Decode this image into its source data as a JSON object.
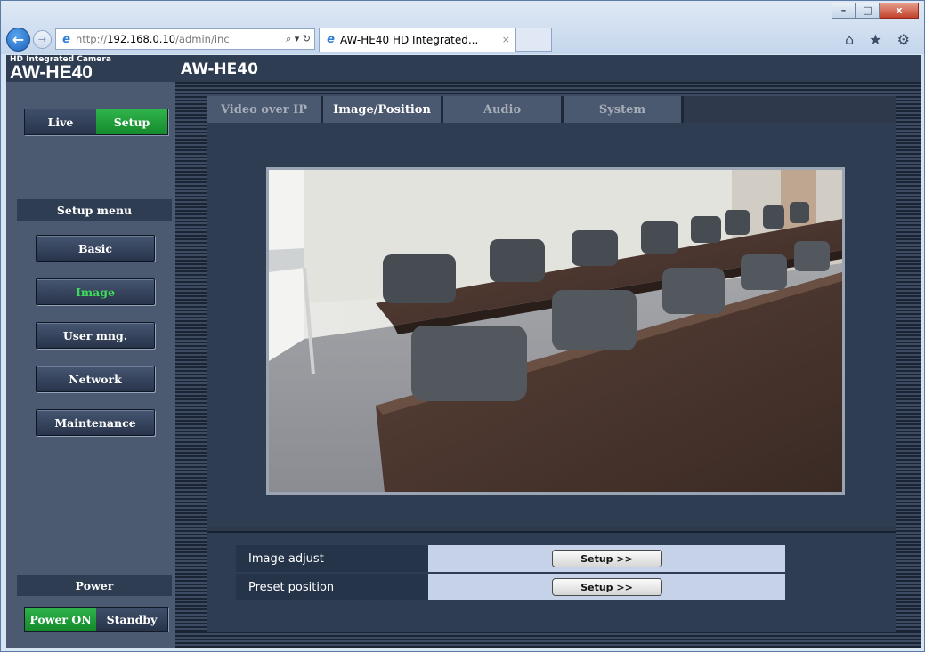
{
  "browser": {
    "address_prefix": "http://",
    "address_host": "192.168.0.10",
    "address_rest": "/admin/inc",
    "address_tools": "⌕ ▾ ↻",
    "tab_title": "AW-HE40 HD Integrated...",
    "tab_close": "×",
    "window_controls": [
      "–",
      "□",
      "x"
    ],
    "toolbar_icons": "⌂ ★ ⚙"
  },
  "header": {
    "brand_small": "HD Integrated Camera",
    "brand_big": "AW-HE40",
    "title": "AW-HE40"
  },
  "mode": {
    "live": "Live",
    "setup": "Setup",
    "active": "setup"
  },
  "setup_menu": {
    "title": "Setup menu",
    "items": [
      {
        "label": "Basic",
        "active": false
      },
      {
        "label": "Image",
        "active": true
      },
      {
        "label": "User mng.",
        "active": false
      },
      {
        "label": "Network",
        "active": false
      },
      {
        "label": "Maintenance",
        "active": false
      }
    ]
  },
  "power": {
    "title": "Power",
    "on": "Power ON",
    "standby": "Standby",
    "active": "on"
  },
  "tabs": [
    {
      "label": "Video over IP",
      "active": false
    },
    {
      "label": "Image/Position",
      "active": true
    },
    {
      "label": "Audio",
      "active": false
    },
    {
      "label": "System",
      "active": false
    }
  ],
  "settings": [
    {
      "label": "Image adjust",
      "button": "Setup >>"
    },
    {
      "label": "Preset position",
      "button": "Setup >>"
    }
  ],
  "colors": {
    "active_green": "#1f9f38",
    "active_text_green": "#3ddc5a",
    "panel_dark": "#2f3d52",
    "row_value_bg": "#c5d2e8"
  }
}
